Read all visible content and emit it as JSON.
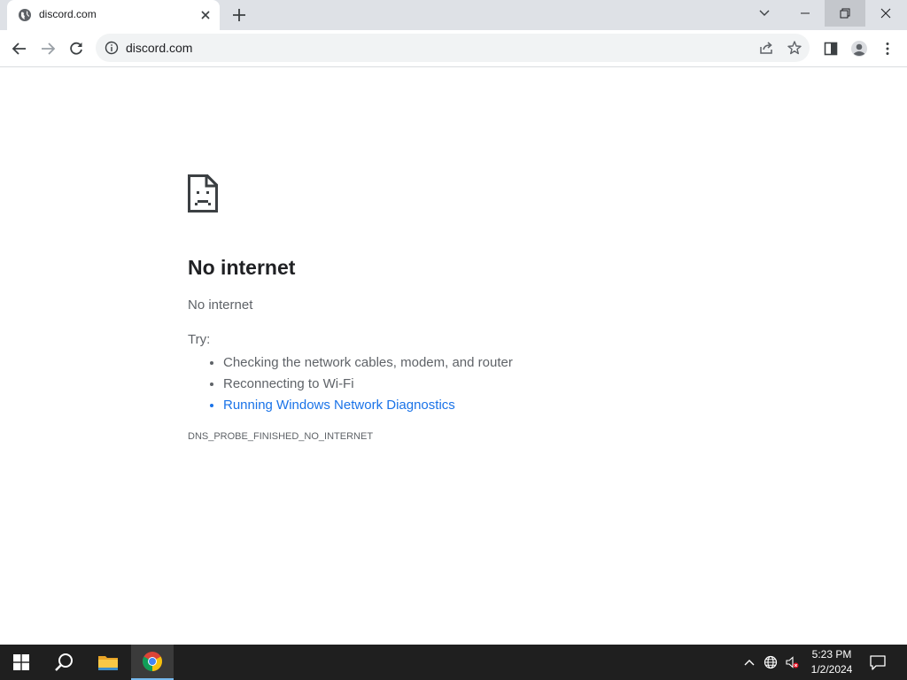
{
  "browser": {
    "tab": {
      "title": "discord.com",
      "favicon": "globe-icon"
    },
    "window_controls": [
      "tab-search-icon",
      "minimize-icon",
      "restore-icon",
      "close-icon"
    ],
    "omnibox": {
      "url": "discord.com"
    }
  },
  "error_page": {
    "title": "No internet",
    "subtitle": "No internet",
    "try_label": "Try:",
    "suggestions": [
      "Checking the network cables, modem, and router",
      "Reconnecting to Wi-Fi",
      "Running Windows Network Diagnostics"
    ],
    "error_code": "DNS_PROBE_FINISHED_NO_INTERNET"
  },
  "taskbar": {
    "apps": [
      "windows-start-icon",
      "search-icon",
      "file-explorer-icon",
      "chrome-icon"
    ],
    "tray": [
      "chevron-up-icon",
      "network-globe-icon",
      "volume-muted-icon"
    ],
    "time": "5:23 PM",
    "date": "1/2/2024"
  },
  "colors": {
    "link": "#1a73e8",
    "tabstrip": "#dee1e6",
    "taskbar": "#1f1f1f"
  }
}
